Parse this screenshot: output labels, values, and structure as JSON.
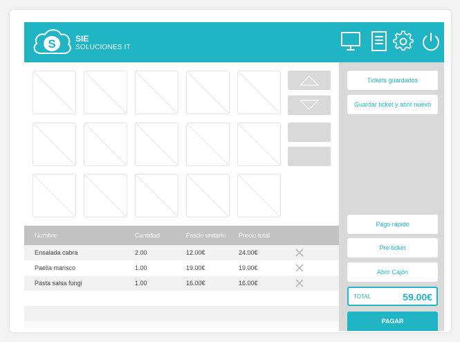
{
  "brand": {
    "name": "SIE",
    "subtitle": "SOLUCIONES IT",
    "logo_letter": "S"
  },
  "header_icons": [
    "monitor-icon",
    "document-icon",
    "gear-icon",
    "power-icon"
  ],
  "colors": {
    "accent": "#1fb5c4",
    "panel": "#d9d9d9",
    "header_row": "#c2c2c2"
  },
  "table": {
    "headers": {
      "name": "Nombre",
      "qty": "Cantidad",
      "unit_price": "Precio unitario",
      "total_price": "Precio total"
    },
    "rows": [
      {
        "name": "Ensalada cabra",
        "qty": "2.00",
        "unit_price": "12.00€",
        "total_price": "24.00€"
      },
      {
        "name": "Paella marisco",
        "qty": "1.00",
        "unit_price": "19.00€",
        "total_price": "19.00€"
      },
      {
        "name": "Pasta salsa fungi",
        "qty": "1.00",
        "unit_price": "16.00€",
        "total_price": "16.00€"
      }
    ]
  },
  "side": {
    "saved_tickets": "Tickets guardados",
    "save_and_new": "Guardar ticket y abrir nuevo",
    "quick_pay": "Pago rápido",
    "pre_ticket": "Pre-ticket",
    "open_drawer": "Abrir Cajón",
    "total_label": "TOTAL",
    "total_value": "59.00€",
    "pay": "PAGAR"
  }
}
